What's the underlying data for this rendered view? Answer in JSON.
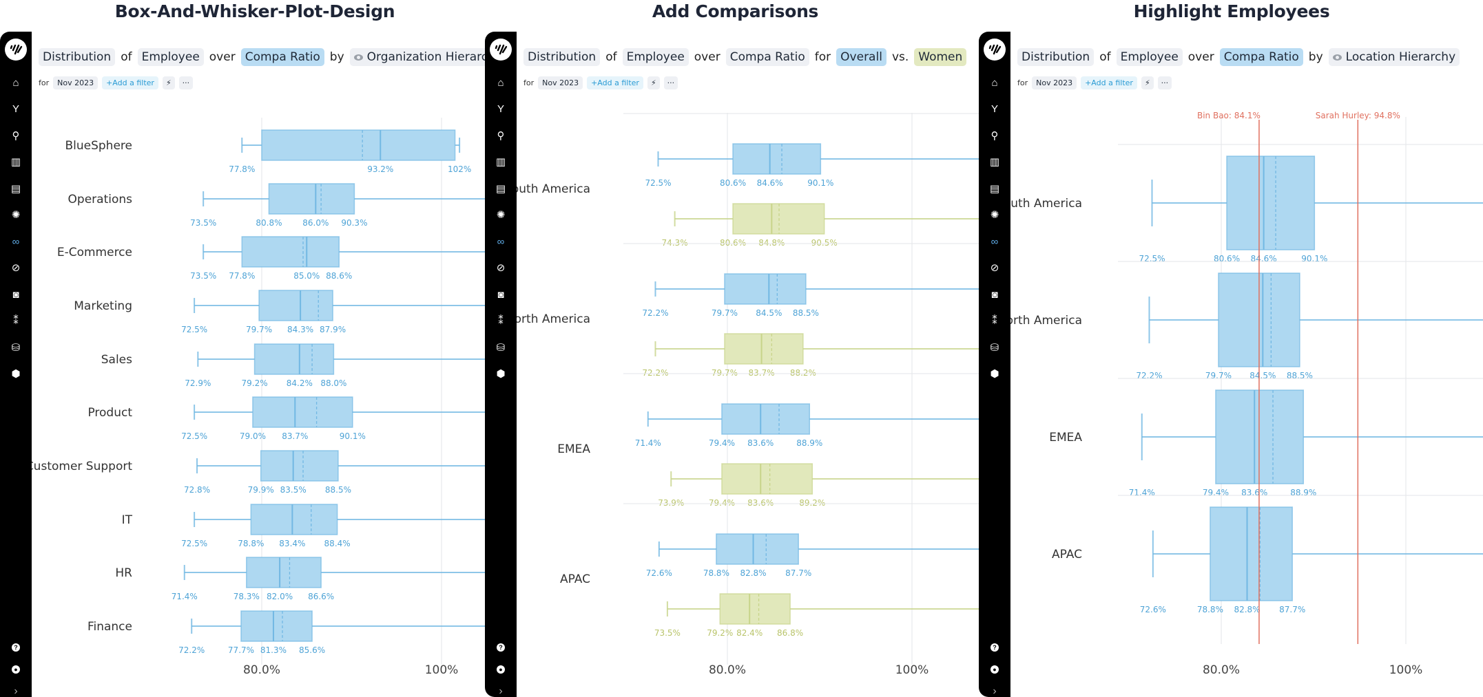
{
  "panels": [
    {
      "title": "Box-And-Whisker-Plot-Design",
      "query": [
        {
          "text": "Distribution",
          "style": "chip"
        },
        {
          "text": "of",
          "style": "word"
        },
        {
          "text": "Employee",
          "style": "chip"
        },
        {
          "text": "over",
          "style": "word"
        },
        {
          "text": "Compa Ratio",
          "style": "chip blue"
        },
        {
          "text": "by",
          "style": "word"
        },
        {
          "text": "Organization Hierarchy",
          "style": "chip",
          "icon": "eye-icon"
        }
      ],
      "filters": {
        "for_label": "for",
        "date": "Nov 2023",
        "add_filter": "+Add a filter",
        "lightning": "⚡",
        "more": "···"
      }
    },
    {
      "title": "Add Comparisons",
      "query": [
        {
          "text": "Distribution",
          "style": "chip"
        },
        {
          "text": "of",
          "style": "word"
        },
        {
          "text": "Employee",
          "style": "chip"
        },
        {
          "text": "over",
          "style": "word"
        },
        {
          "text": "Compa Ratio",
          "style": "chip"
        },
        {
          "text": "for",
          "style": "word"
        },
        {
          "text": "Overall",
          "style": "chip blue"
        },
        {
          "text": "vs.",
          "style": "word"
        },
        {
          "text": "Women",
          "style": "chip green"
        }
      ],
      "filters": {
        "for_label": "for",
        "date": "Nov 2023",
        "add_filter": "+Add a filter",
        "lightning": "⚡",
        "more": "···"
      }
    },
    {
      "title": "Highlight Employees",
      "query": [
        {
          "text": "Distribution",
          "style": "chip"
        },
        {
          "text": "of",
          "style": "word"
        },
        {
          "text": "Employee",
          "style": "chip"
        },
        {
          "text": "over",
          "style": "word"
        },
        {
          "text": "Compa Ratio",
          "style": "chip blue"
        },
        {
          "text": "by",
          "style": "word"
        },
        {
          "text": "Location Hierarchy",
          "style": "chip",
          "icon": "eye-icon"
        }
      ],
      "filters": {
        "for_label": "for",
        "date": "Nov 2023",
        "add_filter": "+Add a filter",
        "lightning": "⚡",
        "more": "···"
      }
    }
  ],
  "sidebar": {
    "top_icons": [
      "home-icon",
      "fork-icon",
      "search-icon",
      "book-icon",
      "report-icon",
      "lightbulb-icon",
      "binoculars-icon",
      "overlap-icon",
      "camera-icon",
      "strategy-icon",
      "database-icon",
      "cube-icon"
    ],
    "active_icon": "binoculars-icon",
    "bottom_icons": [
      "help-icon",
      "user-icon",
      "expand-icon"
    ]
  },
  "colors": {
    "overall_box": "#aed8f1",
    "overall_stroke": "#72b8e3",
    "overall_label": "#4ea3d6",
    "women_box": "#e1e8bb",
    "women_stroke": "#c8d48a",
    "women_label": "#b9c46a",
    "highlight": "#e0705f",
    "sidebar_active": "#5ea9e3"
  },
  "chart_data": [
    {
      "type": "box",
      "title": "Box-And-Whisker-Plot-Design",
      "xlabel": "Compa Ratio",
      "xticks": [
        "80.0%",
        "100%"
      ],
      "xtick_values": [
        80,
        100
      ],
      "xlim": [
        70.9,
        105.5
      ],
      "categories": [
        "BlueSphere",
        "Operations",
        "E-Commerce",
        "Marketing",
        "Sales",
        "Product",
        "Customer Support",
        "IT",
        "HR",
        "Finance"
      ],
      "series": [
        {
          "name": "Overall",
          "boxes": [
            {
              "min": 77.8,
              "q1": 80.0,
              "median": 93.2,
              "mean": 91.2,
              "q3": 101.5,
              "max": 102,
              "labels": [
                "77.8%",
                "93.2%",
                "102%"
              ],
              "label_values": [
                77.8,
                93.2,
                102
              ]
            },
            {
              "min": 73.5,
              "q1": 80.8,
              "median": 86.0,
              "mean": 86.6,
              "q3": 90.3,
              "max": 110,
              "labels": [
                "73.5%",
                "80.8%",
                "86.0%",
                "90.3%"
              ],
              "label_values": [
                73.5,
                80.8,
                86.0,
                90.3
              ]
            },
            {
              "min": 73.5,
              "q1": 77.8,
              "median": 85.0,
              "mean": 84.6,
              "q3": 88.6,
              "max": 110,
              "labels": [
                "73.5%",
                "77.8%",
                "85.0%",
                "88.6%"
              ],
              "label_values": [
                73.5,
                77.8,
                85.0,
                88.6
              ]
            },
            {
              "min": 72.5,
              "q1": 79.7,
              "median": 84.3,
              "mean": 86.3,
              "q3": 87.9,
              "max": 110,
              "labels": [
                "72.5%",
                "79.7%",
                "84.3%",
                "87.9%"
              ],
              "label_values": [
                72.5,
                79.7,
                84.3,
                87.9
              ]
            },
            {
              "min": 72.9,
              "q1": 79.2,
              "median": 84.2,
              "mean": 85.6,
              "q3": 88.0,
              "max": 110,
              "labels": [
                "72.9%",
                "79.2%",
                "84.2%",
                "88.0%"
              ],
              "label_values": [
                72.9,
                79.2,
                84.2,
                88.0
              ]
            },
            {
              "min": 72.5,
              "q1": 79.0,
              "median": 83.7,
              "mean": 86.1,
              "q3": 90.1,
              "max": 110,
              "labels": [
                "72.5%",
                "79.0%",
                "83.7%",
                "90.1%"
              ],
              "label_values": [
                72.5,
                79.0,
                83.7,
                90.1
              ]
            },
            {
              "min": 72.8,
              "q1": 79.9,
              "median": 83.5,
              "mean": 84.6,
              "q3": 88.5,
              "max": 110,
              "labels": [
                "72.8%",
                "79.9%",
                "83.5%",
                "88.5%"
              ],
              "label_values": [
                72.8,
                79.9,
                83.5,
                88.5
              ]
            },
            {
              "min": 72.5,
              "q1": 78.8,
              "median": 83.4,
              "mean": 85.5,
              "q3": 88.4,
              "max": 110,
              "labels": [
                "72.5%",
                "78.8%",
                "83.4%",
                "88.4%"
              ],
              "label_values": [
                72.5,
                78.8,
                83.4,
                88.4
              ]
            },
            {
              "min": 71.4,
              "q1": 78.3,
              "median": 82.0,
              "mean": 83.1,
              "q3": 86.6,
              "max": 110,
              "labels": [
                "71.4%",
                "78.3%",
                "82.0%",
                "86.6%"
              ],
              "label_values": [
                71.4,
                78.3,
                82.0,
                86.6
              ]
            },
            {
              "min": 72.2,
              "q1": 77.7,
              "median": 81.3,
              "mean": 82.3,
              "q3": 85.6,
              "max": 110,
              "labels": [
                "72.2%",
                "77.7%",
                "81.3%",
                "85.6%"
              ],
              "label_values": [
                72.2,
                77.7,
                81.3,
                85.6
              ]
            }
          ]
        }
      ]
    },
    {
      "type": "box",
      "title": "Add Comparisons",
      "xlabel": "Compa Ratio",
      "xticks": [
        "80.0%",
        "100%"
      ],
      "xtick_values": [
        80,
        100
      ],
      "xlim": [
        70.2,
        106.2
      ],
      "categories": [
        "South America",
        "North America",
        "EMEA",
        "APAC"
      ],
      "series": [
        {
          "name": "Overall",
          "boxes": [
            {
              "min": 72.5,
              "q1": 80.6,
              "median": 84.6,
              "mean": 85.9,
              "q3": 90.1,
              "max": 110,
              "labels": [
                "72.5%",
                "80.6%",
                "84.6%",
                "90.1%"
              ],
              "label_values": [
                72.5,
                80.6,
                84.6,
                90.1
              ]
            },
            {
              "min": 72.2,
              "q1": 79.7,
              "median": 84.5,
              "mean": 85.4,
              "q3": 88.5,
              "max": 110,
              "labels": [
                "72.2%",
                "79.7%",
                "84.5%",
                "88.5%"
              ],
              "label_values": [
                72.2,
                79.7,
                84.5,
                88.5
              ]
            },
            {
              "min": 71.4,
              "q1": 79.4,
              "median": 83.6,
              "mean": 85.6,
              "q3": 88.9,
              "max": 110,
              "labels": [
                "71.4%",
                "79.4%",
                "83.6%",
                "88.9%"
              ],
              "label_values": [
                71.4,
                79.4,
                83.6,
                88.9
              ]
            },
            {
              "min": 72.6,
              "q1": 78.8,
              "median": 82.8,
              "mean": 84.2,
              "q3": 87.7,
              "max": 110,
              "labels": [
                "72.6%",
                "78.8%",
                "82.8%",
                "87.7%"
              ],
              "label_values": [
                72.6,
                78.8,
                82.8,
                87.7
              ]
            }
          ]
        },
        {
          "name": "Women",
          "boxes": [
            {
              "min": 74.3,
              "q1": 80.6,
              "median": 84.8,
              "mean": 85.6,
              "q3": 90.5,
              "max": 110,
              "labels": [
                "74.3%",
                "80.6%",
                "84.8%",
                "90.5%"
              ],
              "label_values": [
                74.3,
                80.6,
                84.8,
                90.5
              ]
            },
            {
              "min": 72.2,
              "q1": 79.7,
              "median": 83.7,
              "mean": 84.8,
              "q3": 88.2,
              "max": 110,
              "labels": [
                "72.2%",
                "79.7%",
                "83.7%",
                "88.2%"
              ],
              "label_values": [
                72.2,
                79.7,
                83.7,
                88.2
              ]
            },
            {
              "min": 73.9,
              "q1": 79.4,
              "median": 83.6,
              "mean": 84.6,
              "q3": 89.2,
              "max": 110,
              "labels": [
                "73.9%",
                "79.4%",
                "83.6%",
                "89.2%"
              ],
              "label_values": [
                73.9,
                79.4,
                83.6,
                89.2
              ]
            },
            {
              "min": 73.5,
              "q1": 79.2,
              "median": 82.4,
              "mean": 83.4,
              "q3": 86.8,
              "max": 110,
              "labels": [
                "73.5%",
                "79.2%",
                "82.4%",
                "86.8%"
              ],
              "label_values": [
                73.5,
                79.2,
                82.4,
                86.8
              ]
            }
          ]
        }
      ]
    },
    {
      "type": "box",
      "title": "Highlight Employees",
      "xlabel": "Compa Ratio",
      "xticks": [
        "80.0%",
        "100%"
      ],
      "xtick_values": [
        80,
        100
      ],
      "xlim": [
        71.4,
        106.0
      ],
      "categories": [
        "South America",
        "North America",
        "EMEA",
        "APAC"
      ],
      "series": [
        {
          "name": "Overall",
          "boxes": [
            {
              "min": 72.5,
              "q1": 80.6,
              "median": 84.6,
              "mean": 85.9,
              "q3": 90.1,
              "max": 110,
              "labels": [
                "72.5%",
                "80.6%",
                "84.6%",
                "90.1%"
              ],
              "label_values": [
                72.5,
                80.6,
                84.6,
                90.1
              ]
            },
            {
              "min": 72.2,
              "q1": 79.7,
              "median": 84.5,
              "mean": 85.4,
              "q3": 88.5,
              "max": 110,
              "labels": [
                "72.2%",
                "79.7%",
                "84.5%",
                "88.5%"
              ],
              "label_values": [
                72.2,
                79.7,
                84.5,
                88.5
              ]
            },
            {
              "min": 71.4,
              "q1": 79.4,
              "median": 83.6,
              "mean": 85.6,
              "q3": 88.9,
              "max": 110,
              "labels": [
                "71.4%",
                "79.4%",
                "83.6%",
                "88.9%"
              ],
              "label_values": [
                71.4,
                79.4,
                83.6,
                88.9
              ]
            },
            {
              "min": 72.6,
              "q1": 78.8,
              "median": 82.8,
              "mean": 84.2,
              "q3": 87.7,
              "max": 110,
              "labels": [
                "72.6%",
                "78.8%",
                "82.8%",
                "87.7%"
              ],
              "label_values": [
                72.6,
                78.8,
                82.8,
                87.7
              ]
            }
          ]
        }
      ],
      "highlights": [
        {
          "name": "Bin Bao",
          "value": 84.1,
          "label": "Bin Bao: 84.1%"
        },
        {
          "name": "Sarah Hurley",
          "value": 94.8,
          "label": "Sarah Hurley: 94.8%"
        }
      ]
    }
  ]
}
